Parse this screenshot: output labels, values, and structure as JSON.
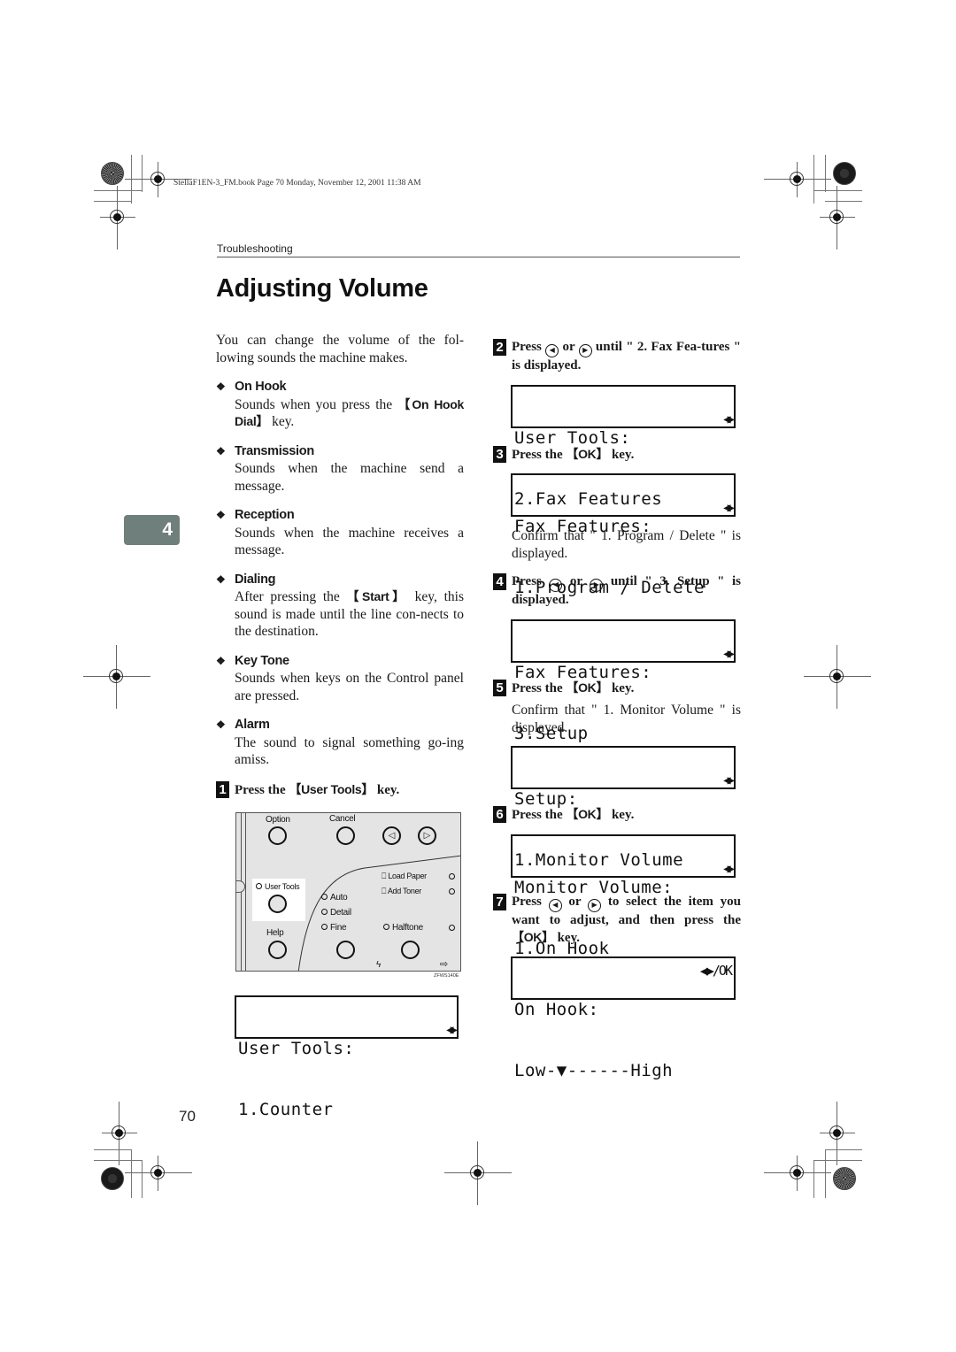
{
  "print_info": "StellaF1EN-3_FM.book  Page 70  Monday, November 12, 2001  11:38 AM",
  "running_head": "Troubleshooting",
  "page_title": "Adjusting Volume",
  "chapter_tab": "4",
  "page_number": "70",
  "intro": "You can change the volume of the fol-lowing sounds the machine makes.",
  "features": [
    {
      "title": "On Hook",
      "body_before": "Sounds when you press the ",
      "key": "【On Hook Dial】",
      "body_after": " key."
    },
    {
      "title": "Transmission",
      "body_before": "Sounds when the machine send a message.",
      "key": "",
      "body_after": ""
    },
    {
      "title": "Reception",
      "body_before": "Sounds when the machine receives a message.",
      "key": "",
      "body_after": ""
    },
    {
      "title": "Dialing",
      "body_before": "After pressing the ",
      "key": "【Start】",
      "body_after": " key, this sound is made until the line con-nects to the destination."
    },
    {
      "title": "Key Tone",
      "body_before": "Sounds when keys on the Control panel are pressed.",
      "key": "",
      "body_after": ""
    },
    {
      "title": "Alarm",
      "body_before": "The sound to signal something go-ing amiss.",
      "key": "",
      "body_after": ""
    }
  ],
  "steps": [
    {
      "num": "1",
      "before": "Press the ",
      "key": "【User Tools】",
      "after": " key."
    },
    {
      "num": "2",
      "before": "Press ",
      "mid": " or ",
      "after": " until \" 2. Fax Fea-tures \" is displayed."
    },
    {
      "num": "3",
      "before": "Press the ",
      "key": "【OK】",
      "after": " key."
    },
    {
      "num": "4",
      "before": "Press ",
      "mid": " or ",
      "after": " until \" 3. Setup \" is displayed."
    },
    {
      "num": "5",
      "before": "Press the ",
      "key": "【OK】",
      "after": " key."
    },
    {
      "num": "6",
      "before": "Press the ",
      "key": "【OK】",
      "after": " key."
    },
    {
      "num": "7",
      "before": "Press ",
      "mid": " or ",
      "after": " to select the item you want to adjust, and then press the ",
      "key": "【OK】",
      "after2": " key."
    }
  ],
  "confirm_texts": [
    "Confirm that \" 1. Program / Delete \" is displayed.",
    "Confirm that \" 1. Monitor Volume \" is displayed."
  ],
  "lcd_screens": [
    {
      "line1": "User Tools:",
      "line2": "1.Counter",
      "indicator": "◀▶"
    },
    {
      "line1": "User Tools:",
      "line2": "2.Fax Features",
      "indicator": "◀▶"
    },
    {
      "line1": "Fax Features:",
      "line2": "1.Program / Delete",
      "indicator": "◀▶"
    },
    {
      "line1": "Fax Features:",
      "line2": "3.Setup",
      "indicator": "◀▶"
    },
    {
      "line1": "Setup:",
      "line2": "1.Monitor Volume",
      "indicator": "◀▶"
    },
    {
      "line1": "Monitor Volume:",
      "line2": "1.On Hook",
      "indicator": "◀▶"
    },
    {
      "line1": "On Hook:",
      "line2": "Low-▼------High",
      "indicator": "◀▶/OK",
      "volume_level": "1 of 7"
    }
  ],
  "control_panel": {
    "labels": {
      "option": "Option",
      "cancel": "Cancel",
      "user_tools": "User Tools",
      "help": "Help",
      "auto": "Auto",
      "detail": "Detail",
      "fine": "Fine",
      "halftone": "Halftone",
      "load_paper": "Load Paper",
      "add_toner": "Add Toner"
    },
    "figure_code": "ZFWS140E"
  },
  "icons": {
    "left_arrow": "◁",
    "right_arrow": "▷",
    "diamond": "❖",
    "lcd_arrows": "◀▶"
  }
}
